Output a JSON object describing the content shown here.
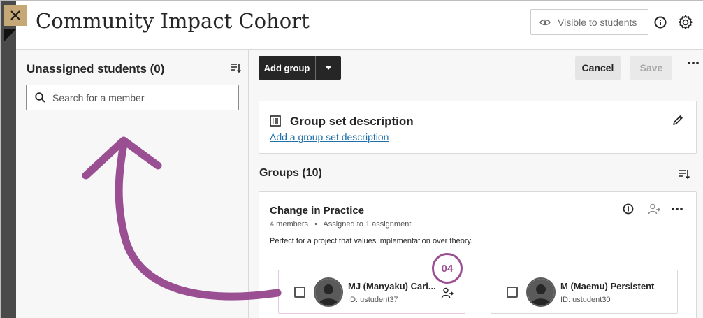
{
  "header": {
    "title": "Community Impact Cohort",
    "visibility_label": "Visible to students"
  },
  "unassigned": {
    "title": "Unassigned students (0)",
    "search_placeholder": "Search for a member"
  },
  "toolbar": {
    "add_group_label": "Add group",
    "cancel_label": "Cancel",
    "save_label": "Save"
  },
  "description_card": {
    "title": "Group set description",
    "link": "Add a group set description"
  },
  "groups": {
    "title": "Groups (10)",
    "items": [
      {
        "name": "Change in Practice",
        "members_count": "4 members",
        "separator": "•",
        "assignment": "Assigned to 1 assignment",
        "description": "Perfect for a project that values implementation over theory.",
        "members": [
          {
            "name": "MJ (Manyaku) Cari...",
            "id": "ID: ustudent37"
          },
          {
            "name": "M (Maemu) Persistent",
            "id": "ID: ustudent30"
          }
        ]
      }
    ]
  },
  "callout": {
    "step": "04",
    "color": "#9a4f93"
  },
  "colors": {
    "accent_dark": "#262626",
    "link": "#1f6fa8",
    "callout": "#9a4f93",
    "close_tile": "#c6a877"
  }
}
